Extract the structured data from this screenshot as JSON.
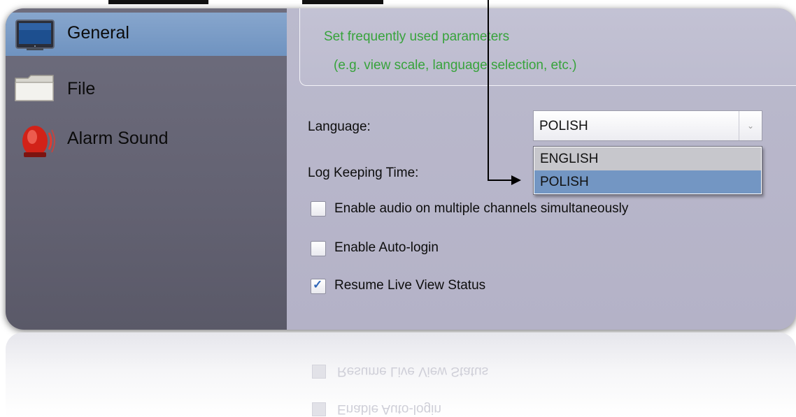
{
  "sidebar": {
    "items": [
      {
        "label": "General",
        "icon": "monitor-icon"
      },
      {
        "label": "File",
        "icon": "folder-icon"
      },
      {
        "label": "Alarm Sound",
        "icon": "alarm-siren-icon"
      }
    ],
    "selected": "General"
  },
  "content": {
    "description_line1": "Set frequently used parameters",
    "description_line2": "(e.g. view scale, language selection, etc.)",
    "language_label": "Language:",
    "language_value": "POLISH",
    "language_options": [
      "ENGLISH",
      "POLISH"
    ],
    "highlighted_option": "POLISH",
    "log_keeping_label": "Log Keeping Time:",
    "checkboxes": [
      {
        "label": "Enable audio on multiple channels simultaneously",
        "checked": false
      },
      {
        "label": "Enable Auto-login",
        "checked": false
      },
      {
        "label": "Resume Live View Status",
        "checked": true
      }
    ]
  },
  "reflection": {
    "line1": "Resume Live View Status",
    "line2": "Enable Auto-login"
  },
  "colors": {
    "accent_description": "#37a33b",
    "selected_item": "#7396c3",
    "sidebar_bg": "#636272",
    "content_bg": "#b6b4c9"
  }
}
